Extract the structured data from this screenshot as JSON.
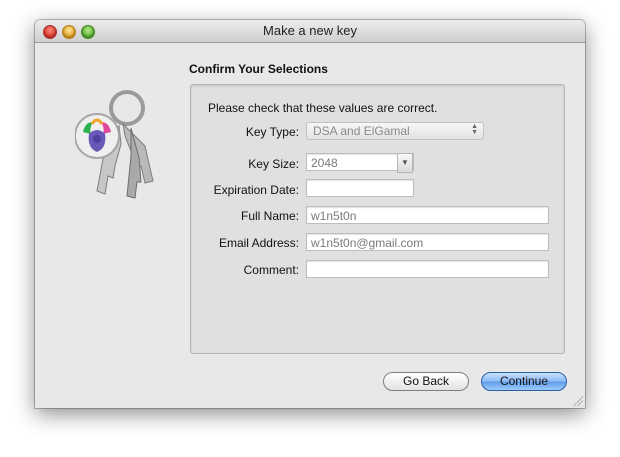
{
  "window": {
    "title": "Make a new key"
  },
  "section": {
    "heading": "Confirm Your Selections"
  },
  "panel": {
    "intro": "Please check that these values are correct.",
    "fields": {
      "key_type": {
        "label": "Key Type:",
        "value": "DSA and ElGamal"
      },
      "key_size": {
        "label": "Key Size:",
        "value": "2048"
      },
      "expiration_date": {
        "label": "Expiration Date:",
        "value": ""
      },
      "full_name": {
        "label": "Full Name:",
        "value": "w1n5t0n"
      },
      "email_address": {
        "label": "Email Address:",
        "value": "w1n5t0n@gmail.com"
      },
      "comment": {
        "label": "Comment:",
        "value": ""
      }
    }
  },
  "buttons": {
    "back": "Go Back",
    "continue": "Continue"
  },
  "icons": {
    "app": "gpg-keychain-icon",
    "popup_arrows": "updown-arrows-icon",
    "combo_arrow": "triangle-down-icon"
  },
  "colors": {
    "default_button": "#6aa5ef",
    "window_bg": "#e8e8e8"
  }
}
